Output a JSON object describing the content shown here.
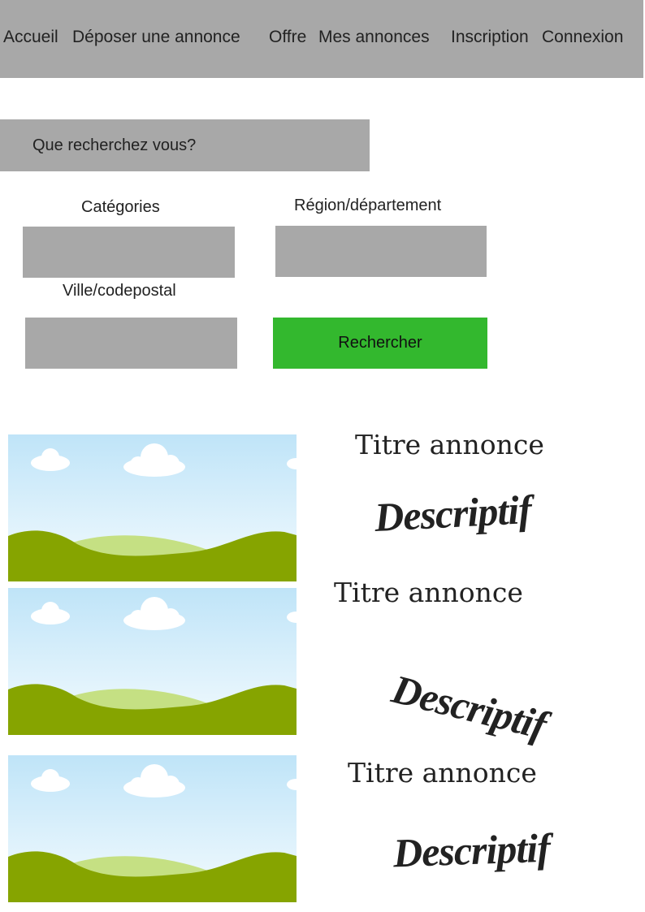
{
  "nav": {
    "items": [
      {
        "label": "Accueil"
      },
      {
        "label": "Déposer une annonce"
      },
      {
        "label": "Offre"
      },
      {
        "label": "Mes annonces"
      },
      {
        "label": "Inscription"
      },
      {
        "label": "Connexion"
      }
    ]
  },
  "search": {
    "placeholder": "Que recherchez vous?",
    "categories_label": "Catégories",
    "region_label": "Région/département",
    "city_label": "Ville/codepostal",
    "button_label": "Rechercher"
  },
  "listings": [
    {
      "title": "Titre annonce",
      "description": "Descriptif",
      "image": "landscape-placeholder"
    },
    {
      "title": "Titre annonce",
      "description": "Descriptif",
      "image": "landscape-placeholder"
    },
    {
      "title": "Titre annonce",
      "description": "Descriptif",
      "image": "landscape-placeholder"
    }
  ],
  "colors": {
    "nav_bg": "#a8a8a8",
    "field_bg": "#a8a8a8",
    "button_bg": "#33b82e",
    "sky": "#c8e8f8",
    "hill_dark": "#86a400",
    "hill_light": "#c5e083"
  }
}
